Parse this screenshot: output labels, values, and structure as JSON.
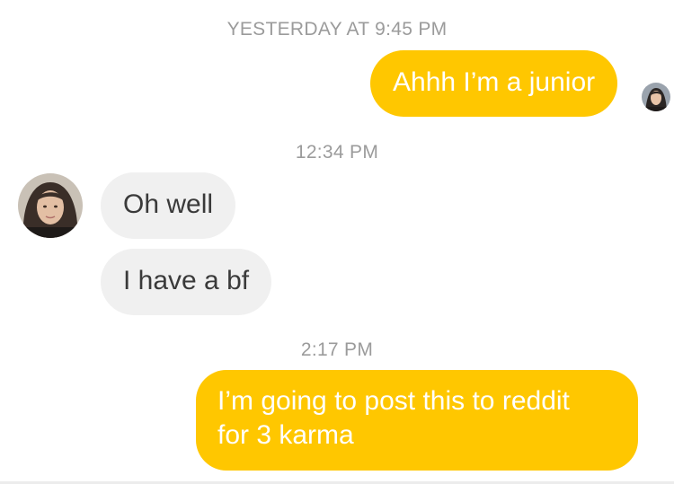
{
  "conversation": {
    "timestamps": {
      "first": "YESTERDAY AT 9:45 PM",
      "second": "12:34 PM",
      "third": "2:17 PM"
    },
    "messages": [
      {
        "from": "me",
        "text": "Ahhh I’m a junior"
      },
      {
        "from": "match",
        "text": "Oh well"
      },
      {
        "from": "match",
        "text": "I have a bf"
      },
      {
        "from": "me",
        "line1": "I’m going to post this to reddit",
        "line2": "for 3 karma"
      }
    ]
  },
  "avatars": {
    "self": "user-avatar",
    "match": "match-avatar"
  },
  "colors": {
    "sent_bubble": "#ffc700",
    "received_bubble": "#f0f0f0",
    "timestamp_text": "#9b9b9b",
    "background": "#ffffff"
  }
}
